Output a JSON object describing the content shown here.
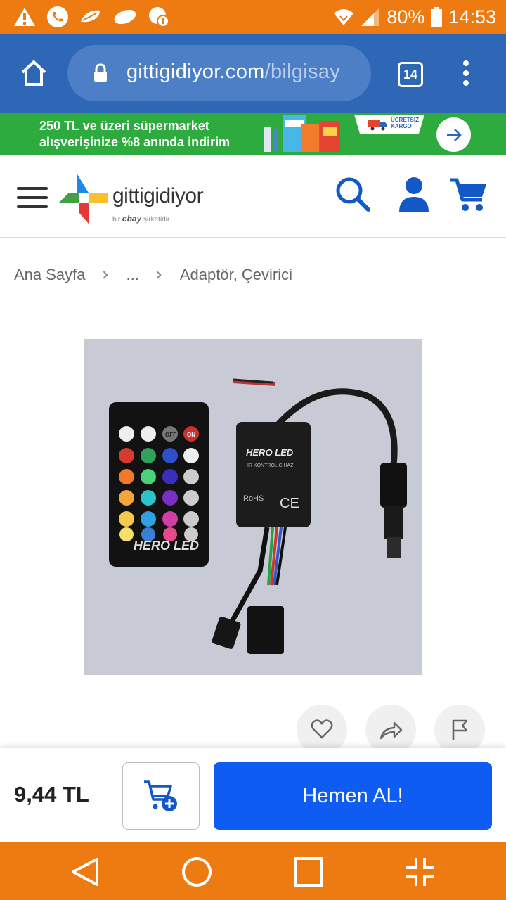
{
  "status_bar": {
    "battery": "80%",
    "time": "14:53",
    "icons": [
      "warning-icon",
      "phone-icon",
      "leaf-icon",
      "leaf-icon",
      "game-icon",
      "wifi-icon",
      "signal-icon",
      "battery-icon"
    ]
  },
  "browser": {
    "url_host": "gittigidiyor.com",
    "url_path": "/bilgisay",
    "tab_count": "14",
    "icons": [
      "home-icon",
      "lock-icon",
      "tabs-icon",
      "more-vert-icon"
    ]
  },
  "promo": {
    "line1": "250 TL ve üzeri süpermarket",
    "line2": "alışverişinize %8 anında indirim",
    "badge_line1": "ÜCRETSİZ",
    "badge_line2": "KARGO"
  },
  "header": {
    "logo_text": "gittigidiyor",
    "logo_sub_prefix": "bir",
    "logo_sub_brand": "ebay",
    "logo_sub_suffix": "şirketidir",
    "icons": [
      "menu-icon",
      "search-icon",
      "user-icon",
      "cart-icon"
    ]
  },
  "breadcrumb": {
    "items": [
      "Ana Sayfa",
      "...",
      "Adaptör, Çevirici"
    ]
  },
  "product": {
    "image_alt": "IR kontrol cihazı ve kumanda",
    "device_brand": "HERO LED",
    "device_label": "IR KONTROL CİHAZI",
    "ce_mark": "CE",
    "rohs": "RoHS",
    "remote_off": "OFF",
    "remote_on": "ON"
  },
  "actions": {
    "icons": [
      "heart-icon",
      "share-icon",
      "flag-icon"
    ]
  },
  "buy_bar": {
    "price": "9,44 TL",
    "buy_now_label": "Hemen AL!"
  },
  "colors": {
    "status_orange": "#ee7a12",
    "browser_blue": "#2f67b7",
    "promo_green": "#2dab3f",
    "brand_blue": "#0e5cf2"
  }
}
